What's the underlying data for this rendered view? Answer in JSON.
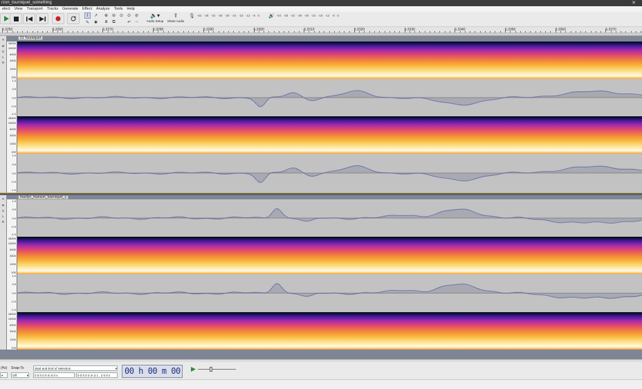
{
  "window": {
    "title": "rzon_tourniquet_something"
  },
  "menu": [
    "elect",
    "View",
    "Transport",
    "Tracks",
    "Generate",
    "Effect",
    "Analyze",
    "Tools",
    "Help"
  ],
  "toolbar": {
    "audio_setup": "Audio Setup",
    "share_audio": "Share Audio",
    "meter_scale": [
      "-54",
      "-48",
      "-42",
      "-36",
      "-30",
      "-24",
      "-18",
      "-12",
      "-6",
      "0"
    ],
    "playback_meter_scale": [
      "-54",
      "-48",
      "-42",
      "-36",
      "-30",
      "-24",
      "-18",
      "-12",
      "-6",
      "0"
    ]
  },
  "ruler": {
    "labels": [
      "5.3250",
      "5.3260",
      "5.3270",
      "5.3280",
      "5.3290",
      "5.3300",
      "5.3310",
      "5.3320",
      "5.3330",
      "5.3340",
      "5.3350",
      "5.3360",
      "5.3370"
    ]
  },
  "tracks": [
    {
      "name": "01 Tourniquet"
    },
    {
      "name": "marilyn_manson_tourniquet_s"
    }
  ],
  "spectrogram_scale": [
    "18000",
    "10000",
    "6000",
    "3000",
    "1000",
    "100"
  ],
  "wave_scale": [
    "1.0",
    "0.5",
    "0.0",
    "-0.5",
    "-1.0"
  ],
  "selection_toolbar": {
    "rate_label": "(Hz)",
    "snap_label": "Snap-To",
    "snap_value": "Off",
    "selection_mode": "Start and End of Selection",
    "start_value": "0 0 h 0 0 m 0 0 s",
    "end_value": "0 0 h 0 4 m 3 1 . 2 0 0 s",
    "time_display": "00 h 00 m 00 s"
  }
}
